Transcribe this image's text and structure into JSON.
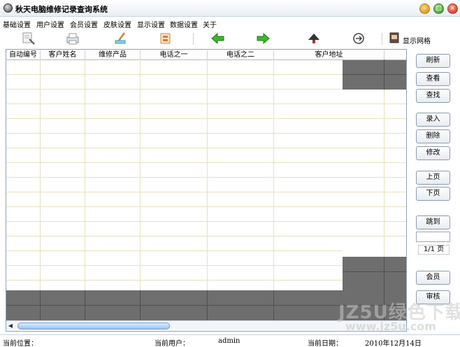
{
  "window": {
    "title": "秋天电脑维修记录查询系统",
    "minimize": "–",
    "maximize": "□",
    "close": "×"
  },
  "menu": [
    "基础设置",
    "用户设置",
    "会员设置",
    "皮肤设置",
    "显示设置",
    "数据设置",
    "关于"
  ],
  "toolbar": {
    "buttons": [
      "search-icon",
      "print-icon",
      "edit-icon",
      "export-icon",
      "arrow-left-icon",
      "arrow-right-icon",
      "skin-icon",
      "refresh-icon"
    ],
    "grid_toggle_label": "显示网格"
  },
  "grid": {
    "columns": [
      "自动编号",
      "客户姓名",
      "维修产品",
      "电话之一",
      "电话之二",
      "客户地址"
    ],
    "rows": []
  },
  "side_buttons": [
    "刷新",
    "查看",
    "查找",
    "录入",
    "删除",
    "修改",
    "上页",
    "下页",
    "跳到",
    "会员",
    "审核"
  ],
  "pagination": {
    "jump_value": "",
    "indicator": "1/1 页"
  },
  "status": {
    "location_label": "当前位置：",
    "location_value": "",
    "user_label": "当前用户：",
    "user_value": "admin",
    "date_label": "当前日期：",
    "date_value": "2010年12月14日"
  },
  "watermark": {
    "line1": "JZ5U绿色下载",
    "line2": "www.jz5u.com"
  },
  "colors": {
    "grid_line": "#e0ddb5",
    "dark_fill": "#6e6e6e",
    "dark_line": "#4f4f4f",
    "window_border": "#8ea2b9"
  }
}
